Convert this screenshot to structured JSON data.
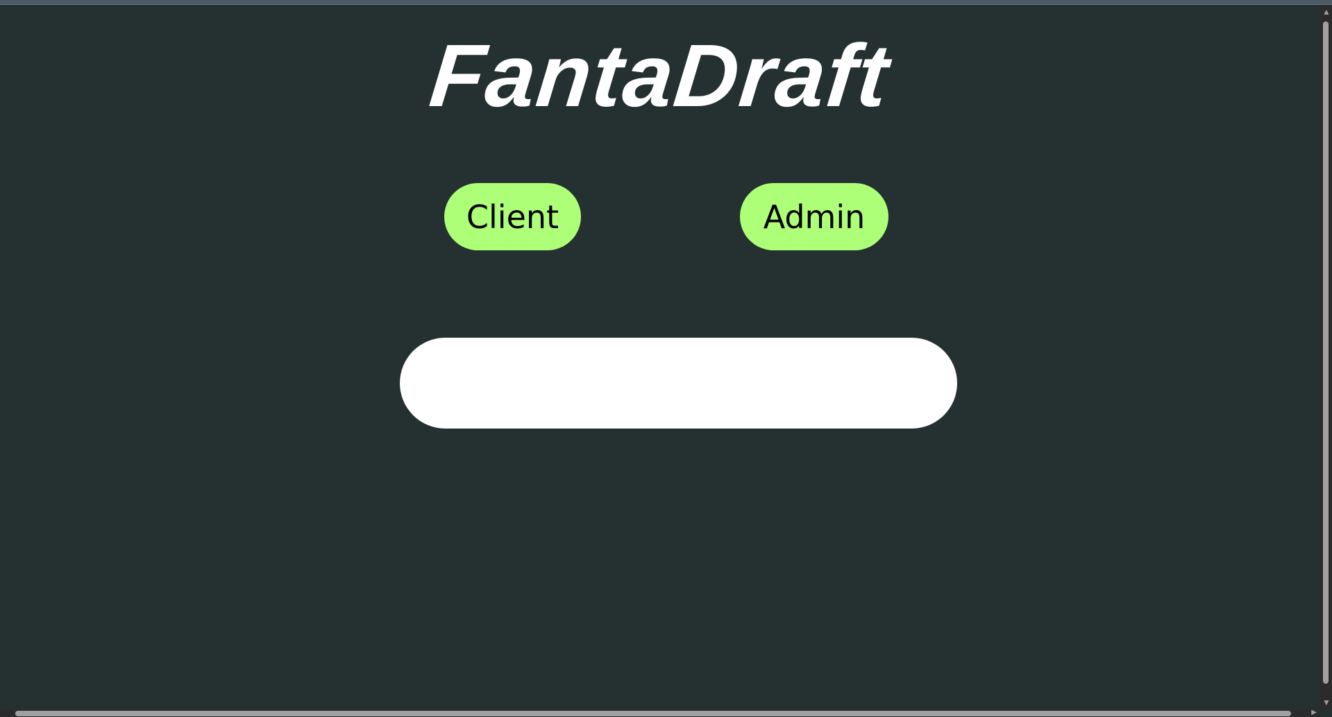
{
  "app": {
    "title": "FantaDraft"
  },
  "buttons": {
    "client_label": "Client",
    "admin_label": "Admin"
  },
  "input": {
    "value": "",
    "placeholder": ""
  },
  "colors": {
    "background": "#253030",
    "button": "#adff78",
    "title": "#ffffff"
  }
}
